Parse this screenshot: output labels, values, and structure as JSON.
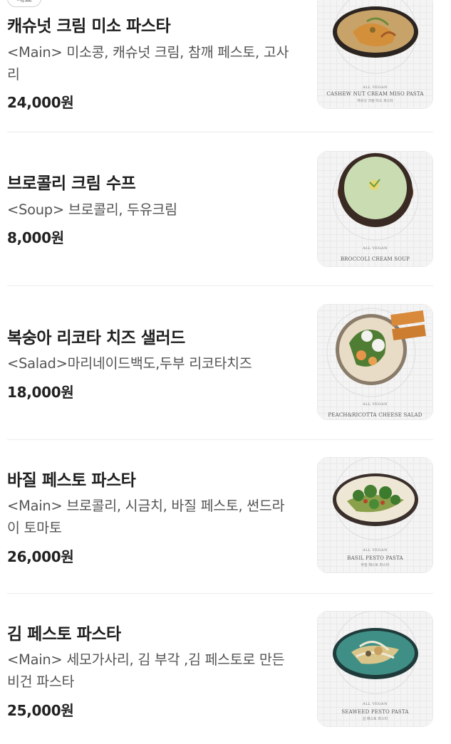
{
  "top_badge": "대표",
  "menu": [
    {
      "name": "캐슈넛 크림 미소 파스타",
      "desc": "<Main> 미소콩, 캐슈넛 크림, 참깨 페스토, 고사리",
      "price": "24,000원",
      "photo": {
        "small": "ALL VEGAN",
        "title": "CASHEW NUT CREAM MISO PASTA",
        "sub": "캐슈넛 크림 미소 파스타",
        "dish": "orange-pasta"
      }
    },
    {
      "name": "브로콜리 크림 수프",
      "desc": "<Soup> 브로콜리, 두유크림",
      "price": "8,000원",
      "photo": {
        "small": "ALL VEGAN",
        "title": "BROCCOLI CREAM SOUP",
        "sub": "",
        "dish": "green-soup"
      }
    },
    {
      "name": "복숭아 리코타 치즈 샐러드",
      "desc": "<Salad>마리네이드백도,두부 리코타치즈",
      "price": "18,000원",
      "photo": {
        "small": "ALL VEGAN",
        "title": "PEACH&RICOTTA CHEESE SALAD",
        "sub": "",
        "dish": "salad"
      }
    },
    {
      "name": "바질 페스토 파스타",
      "desc": "<Main> 브로콜리, 시금치, 바질 페스토, 썬드라이 토마토",
      "price": "26,000원",
      "photo": {
        "small": "ALL VEGAN",
        "title": "BASIL PESTO PASTA",
        "sub": "바질 페스토 파스타",
        "dish": "basil-pasta"
      }
    },
    {
      "name": "김 페스토 파스타",
      "desc": "<Main> 세모가사리, 김 부각 ,김 페스토로 만든 비건 파스타",
      "price": "25,000원",
      "photo": {
        "small": "ALL VEGAN",
        "title": "SEAWEED PESTO PASTA",
        "sub": "김 페스토 파스타",
        "dish": "seaweed-pasta"
      }
    }
  ]
}
